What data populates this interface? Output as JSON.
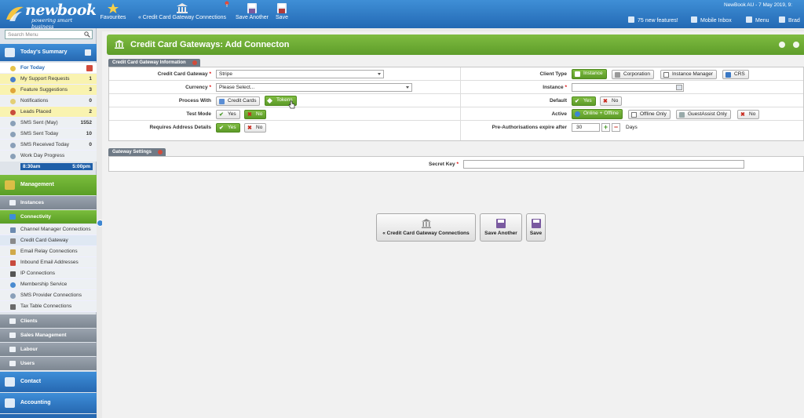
{
  "topbar": {
    "logo_name": "newbook",
    "logo_tagline": "powering smart business",
    "actions": {
      "favourites": "Favourites",
      "back": "« Credit Card Gateway Connections",
      "save_another": "Save Another",
      "save": "Save"
    },
    "status": "NewBook AU - 7 May 2019, 9:",
    "new_features": "75 new features!",
    "mobile_inbox": "Mobile Inbox",
    "menu": "Menu",
    "user": "Brad"
  },
  "sidebar": {
    "search_placeholder": "Search Menu",
    "todays_summary": "Today's Summary",
    "summary_items": [
      {
        "label": "For Today",
        "count": ""
      },
      {
        "label": "My Support Requests",
        "count": "1"
      },
      {
        "label": "Feature Suggestions",
        "count": "3"
      },
      {
        "label": "Notifications",
        "count": "0"
      },
      {
        "label": "Leads Placed",
        "count": "2"
      },
      {
        "label": "SMS Sent (May)",
        "count": "1552"
      },
      {
        "label": "SMS Sent Today",
        "count": "10"
      },
      {
        "label": "SMS Received Today",
        "count": "0"
      },
      {
        "label": "Work Day Progress",
        "count": ""
      }
    ],
    "work_start": "8:30am",
    "work_end": "5:00pm",
    "management": "Management",
    "instances": "Instances",
    "connectivity": "Connectivity",
    "connectivity_items": [
      "Channel Manager Connections",
      "Credit Card Gateway Connections",
      "Email Relay Connections",
      "Inbound Email Addresses",
      "IP Connections",
      "Membership Service Connections",
      "SMS Provider Connections",
      "Tax Table Connections"
    ],
    "clients": "Clients",
    "sales_management": "Sales Management",
    "labour": "Labour",
    "users": "Users",
    "contact": "Contact",
    "accounting": "Accounting"
  },
  "page": {
    "title": "Credit Card Gateways: Add Connecton"
  },
  "info": {
    "tab": "Credit Card Gateway Information",
    "gateway_label": "Credit Card Gateway",
    "gateway_value": "Stripe",
    "currency_label": "Currency",
    "currency_value": "Please Select...",
    "process_label": "Process With",
    "process_options": [
      "Credit Cards",
      "Tokens"
    ],
    "test_label": "Test Mode",
    "address_label": "Requires Address Details",
    "yes": "Yes",
    "no": "No",
    "client_type_label": "Client Type",
    "client_types": [
      "Instance",
      "Corporation",
      "Instance Manager",
      "CRS"
    ],
    "instance_label": "Instance",
    "default_label": "Default",
    "active_label": "Active",
    "active_options": [
      "Online + Offline",
      "Offline Only",
      "GuestAssist Only",
      "No"
    ],
    "preauth_label": "Pre-Authorisations expire after",
    "preauth_value": "30",
    "preauth_unit": "Days"
  },
  "gateway": {
    "tab": "Gateway Settings",
    "secret_label": "Secret Key"
  },
  "footer": {
    "back": "« Credit Card Gateway Connections",
    "save_another": "Save Another",
    "save": "Save"
  },
  "colors": {
    "topbar": "#2f7bc6",
    "accent_green": "#6aab34",
    "required": "#dd0000"
  }
}
